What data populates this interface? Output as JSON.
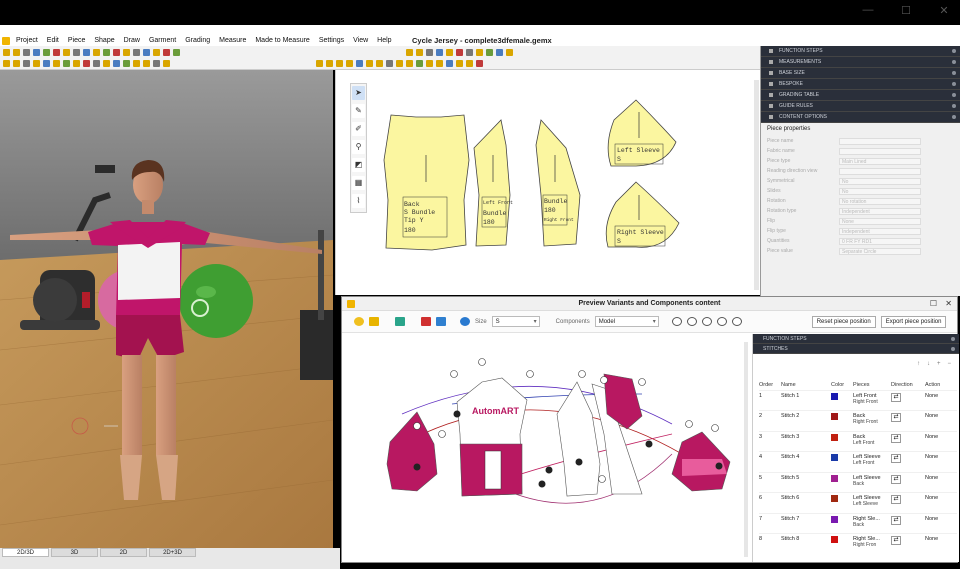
{
  "window": {
    "minimize": "—",
    "maximize": "☐",
    "close": "✕"
  },
  "menu": [
    "Project",
    "Edit",
    "Piece",
    "Shape",
    "Draw",
    "Garment",
    "Grading",
    "Measure",
    "Made to Measure",
    "Settings",
    "View",
    "Help"
  ],
  "doc_title": "Cycle Jersey - complete3dfemale.gemx",
  "bottom_tabs": [
    "2D/3D",
    "3D",
    "2D",
    "2D+3D"
  ],
  "pattern_labels": {
    "back": [
      "Back",
      "S    Bundle",
      "Tip  Y",
      "180"
    ],
    "left_front": [
      "Left Front",
      "Bundle",
      "180"
    ],
    "front": [
      "Bundle",
      "180",
      "Right Front"
    ],
    "left_sleeve": [
      "Left Sleeve",
      "S"
    ],
    "right_sleeve": [
      "Right Sleeve",
      "S"
    ]
  },
  "right_panel": {
    "sections": [
      "FUNCTION STEPS",
      "MEASUREMENTS",
      "BASE SIZE",
      "BESPOKE",
      "GRADING TABLE",
      "GUIDE RULES",
      "CONTENT OPTIONS"
    ],
    "props_title": "Piece properties",
    "props": [
      {
        "label": "Piece name",
        "value": ""
      },
      {
        "label": "Fabric name",
        "value": ""
      },
      {
        "label": "Piece type",
        "value": "Main      Lined"
      },
      {
        "label": "Reading direction view",
        "value": ""
      },
      {
        "label": "Symmetrical",
        "value": "No"
      },
      {
        "label": "Slides",
        "value": "No"
      },
      {
        "label": "Rotation",
        "value": "No rotation"
      },
      {
        "label": "Rotation type",
        "value": "Independent"
      },
      {
        "label": "Flip",
        "value": "None"
      },
      {
        "label": "Flip type",
        "value": "Independent"
      },
      {
        "label": "Quantities",
        "value": "0        FR      FY      RD1"
      },
      {
        "label": "Piece value",
        "value": "Separate       Circle"
      }
    ]
  },
  "dialog": {
    "title": "Preview Variants and Components content",
    "size_label": "Size",
    "size_value": "S",
    "components_label": "Components",
    "components_value": "Model",
    "reset_btn": "Reset piece position",
    "export_btn": "Export piece position",
    "side_sections": [
      "FUNCTION STEPS",
      "STITCHES"
    ],
    "logo_text": "AutomART",
    "table_headers": [
      "Order",
      "Name",
      "Color",
      "Pieces",
      "Direction",
      "Action"
    ],
    "stitches": [
      {
        "order": "1",
        "name": "Stitch 1",
        "color": "#1a1ab0",
        "pieces": [
          "Left Front",
          "Right Front"
        ],
        "action": "None"
      },
      {
        "order": "2",
        "name": "Stitch 2",
        "color": "#a01818",
        "pieces": [
          "Back",
          "Right Front"
        ],
        "action": "None"
      },
      {
        "order": "3",
        "name": "Stitch 3",
        "color": "#c02010",
        "pieces": [
          "Back",
          "Left Front"
        ],
        "action": "None"
      },
      {
        "order": "4",
        "name": "Stitch 4",
        "color": "#1a3aa8",
        "pieces": [
          "Left Sleeve",
          "Left Front"
        ],
        "action": "None"
      },
      {
        "order": "5",
        "name": "Stitch 5",
        "color": "#a02090",
        "pieces": [
          "Left Sleeve",
          "Back"
        ],
        "action": "None"
      },
      {
        "order": "6",
        "name": "Stitch 6",
        "color": "#a02810",
        "pieces": [
          "Left Sleeve",
          "Left Sleeve"
        ],
        "action": "None"
      },
      {
        "order": "7",
        "name": "Stitch 7",
        "color": "#7a1ab0",
        "pieces": [
          "Right Sle...",
          "Back"
        ],
        "action": "None"
      },
      {
        "order": "8",
        "name": "Stitch 8",
        "color": "#d01010",
        "pieces": [
          "Right Sle...",
          "Right Fron"
        ],
        "action": "None"
      }
    ]
  }
}
